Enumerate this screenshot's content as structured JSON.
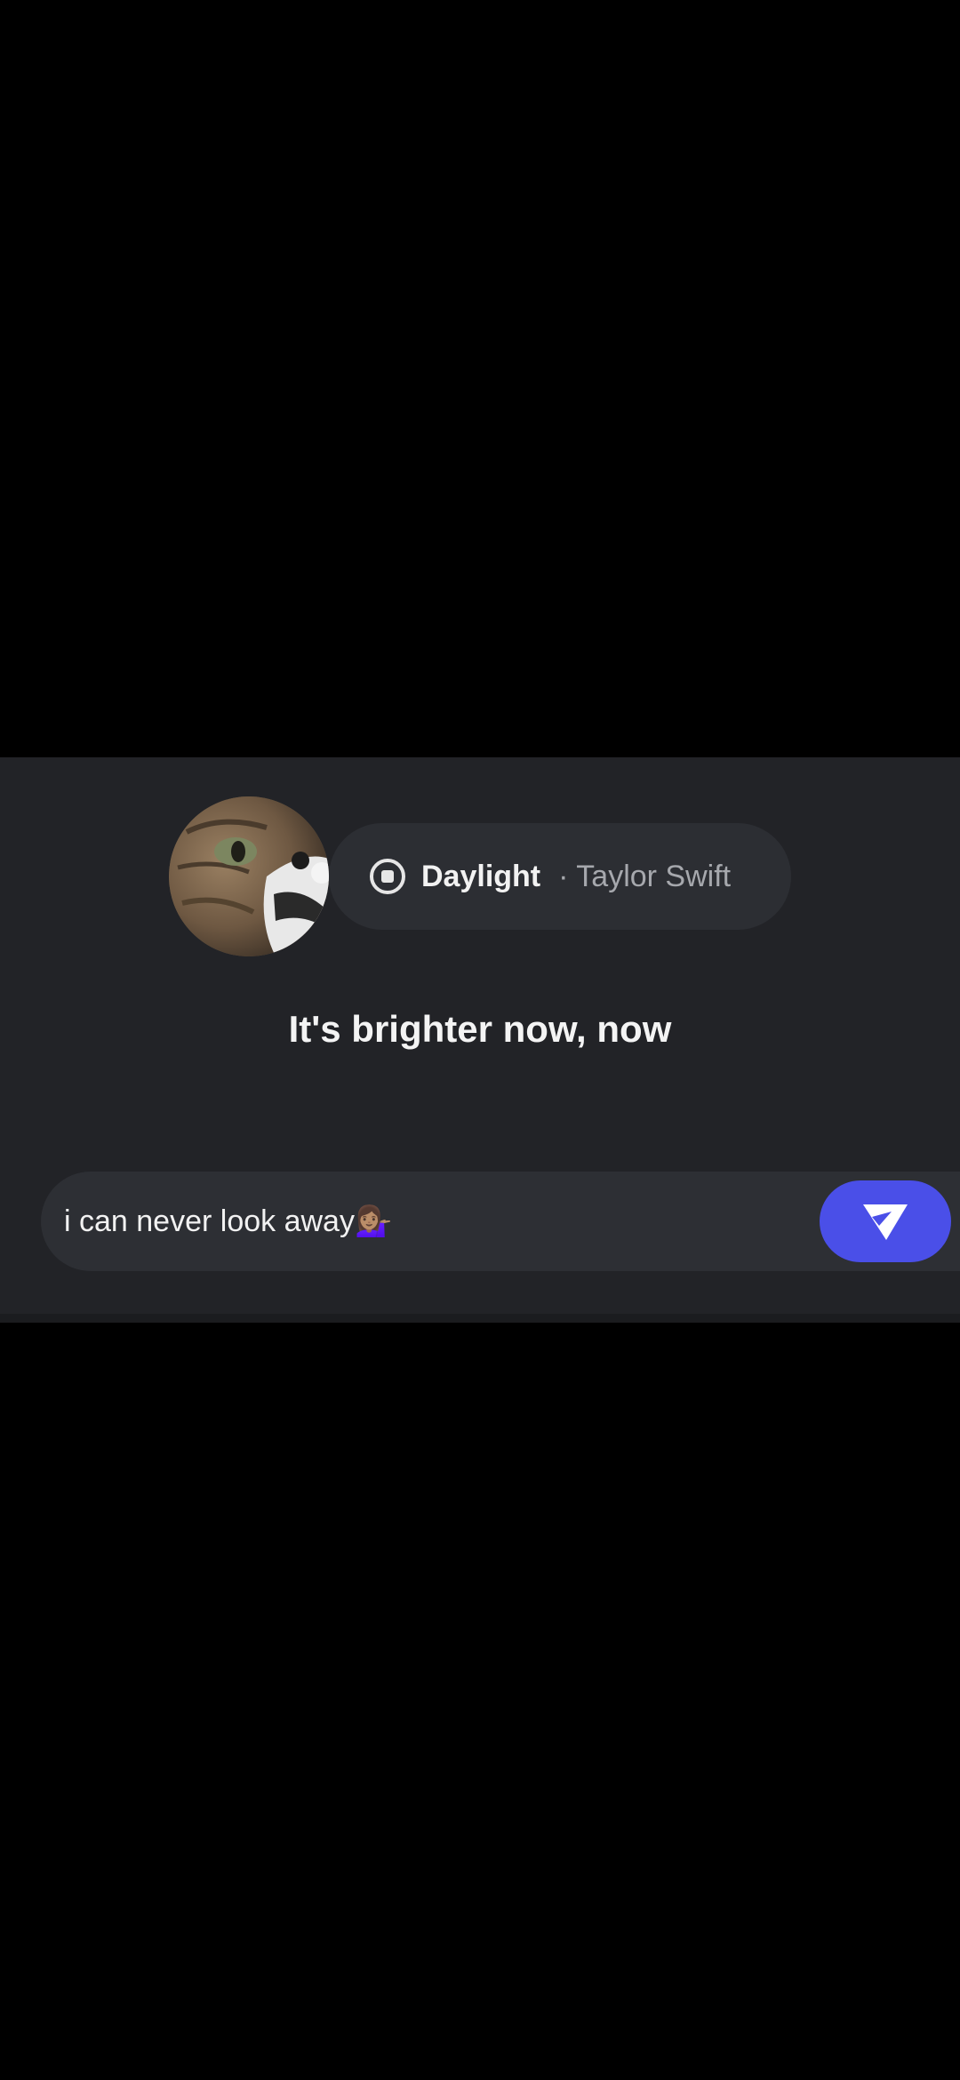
{
  "now_playing": {
    "title": "Daylight",
    "artist": "· Taylor Swift",
    "stop_icon": "stop-circle-icon"
  },
  "lyric": {
    "line": "It's brighter now, now"
  },
  "composer": {
    "message": "i can never look away💁🏽‍♀️",
    "send_icon": "send-icon"
  },
  "colors": {
    "page_bg": "#000000",
    "panel_bg": "#222327",
    "pill_bg": "#2c2e33",
    "send_button": "#4a4fe8",
    "text_primary": "#f2f2f2",
    "text_secondary": "#a6a8ad"
  }
}
